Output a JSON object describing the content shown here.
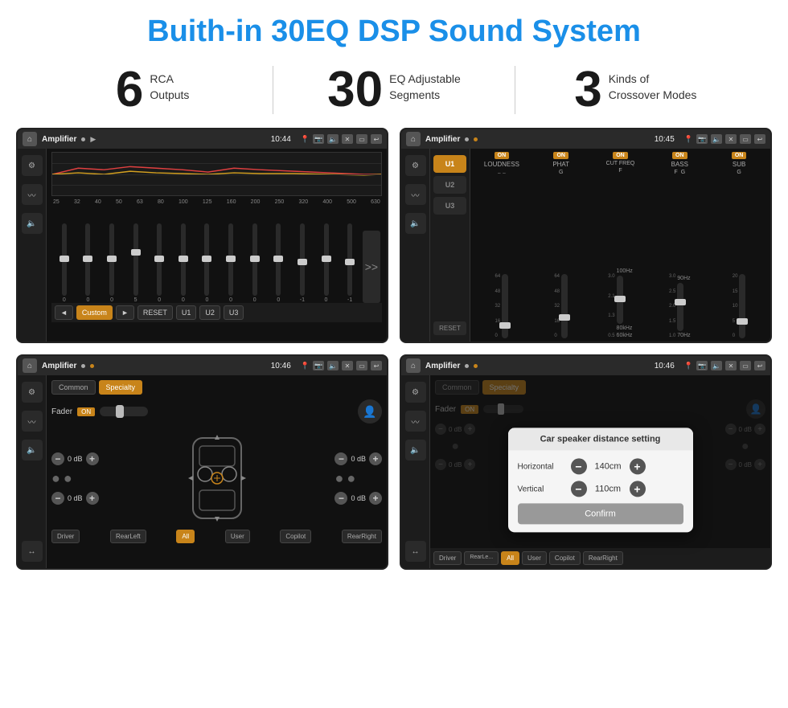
{
  "header": {
    "title": "Buith-in 30EQ DSP Sound System"
  },
  "stats": [
    {
      "number": "6",
      "label": "RCA\nOutputs"
    },
    {
      "number": "30",
      "label": "EQ Adjustable\nSegments"
    },
    {
      "number": "3",
      "label": "Kinds of\nCrossover Modes"
    }
  ],
  "screens": {
    "eq": {
      "app_name": "Amplifier",
      "time": "10:44",
      "freq_labels": [
        "25",
        "32",
        "40",
        "50",
        "63",
        "80",
        "100",
        "125",
        "160",
        "200",
        "250",
        "320",
        "400",
        "500",
        "630"
      ],
      "slider_values": [
        "0",
        "0",
        "0",
        "5",
        "0",
        "0",
        "0",
        "0",
        "0",
        "0",
        "-1",
        "0",
        "-1"
      ],
      "bottom_btns": [
        "◄",
        "Custom",
        "►",
        "RESET",
        "U1",
        "U2",
        "U3"
      ]
    },
    "amp": {
      "app_name": "Amplifier",
      "time": "10:45",
      "presets": [
        "U1",
        "U2",
        "U3"
      ],
      "channels": [
        "LOUDNESS",
        "PHAT",
        "CUT FREQ",
        "BASS",
        "SUB"
      ],
      "channel_on": [
        true,
        true,
        true,
        true,
        true
      ]
    },
    "fader": {
      "app_name": "Amplifier",
      "time": "10:46",
      "tabs": [
        "Common",
        "Specialty"
      ],
      "fader_label": "Fader",
      "fader_on": "ON",
      "vol_values": [
        "0 dB",
        "0 dB",
        "0 dB",
        "0 dB"
      ],
      "bottom_btns": [
        "Driver",
        "RearLeft",
        "All",
        "User",
        "Copilot",
        "RearRight"
      ]
    },
    "dialog": {
      "app_name": "Amplifier",
      "time": "10:46",
      "tabs": [
        "Common",
        "Specialty"
      ],
      "dialog_title": "Car speaker distance setting",
      "horizontal_label": "Horizontal",
      "horizontal_value": "140cm",
      "vertical_label": "Vertical",
      "vertical_value": "110cm",
      "confirm_label": "Confirm",
      "bottom_btns": [
        "Driver",
        "RearLeft",
        "All",
        "User",
        "Copilot",
        "RearRight"
      ]
    }
  },
  "colors": {
    "accent": "#1a8fe8",
    "orange": "#c8841a",
    "bg_dark": "#111111",
    "bg_medium": "#1c1c1c",
    "text_light": "#eeeeee",
    "text_dim": "#888888"
  }
}
